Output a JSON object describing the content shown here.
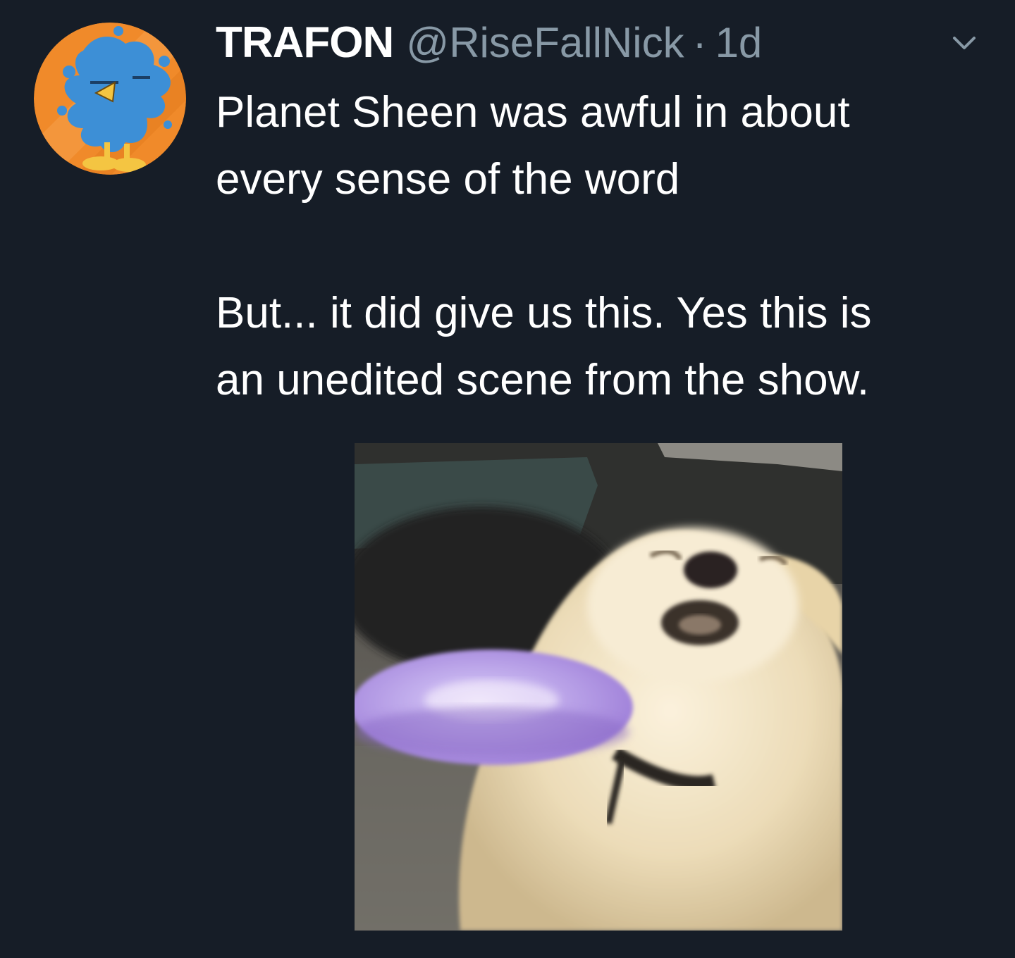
{
  "author": {
    "display_name": "TRAFON",
    "handle": "@RiseFallNick",
    "separator": "·",
    "time": "1d",
    "avatar_icon": "cartoon-bird-avatar-icon"
  },
  "tweet": {
    "lines": [
      "Planet Sheen was awful in about",
      "every sense of the word",
      "",
      "But... it did give us this. Yes this is",
      "an unedited scene from the show."
    ]
  },
  "media": {
    "subject": "dog-catching-frisbee-photo"
  },
  "colors": {
    "background": "#161d27",
    "text_primary": "#ffffff",
    "text_secondary": "#8899a6",
    "avatar_orange": "#f08a2a",
    "avatar_blue": "#3d8fd6",
    "frisbee_purple": "#a98be0"
  },
  "icons": {
    "menu": "chevron-down-icon"
  }
}
